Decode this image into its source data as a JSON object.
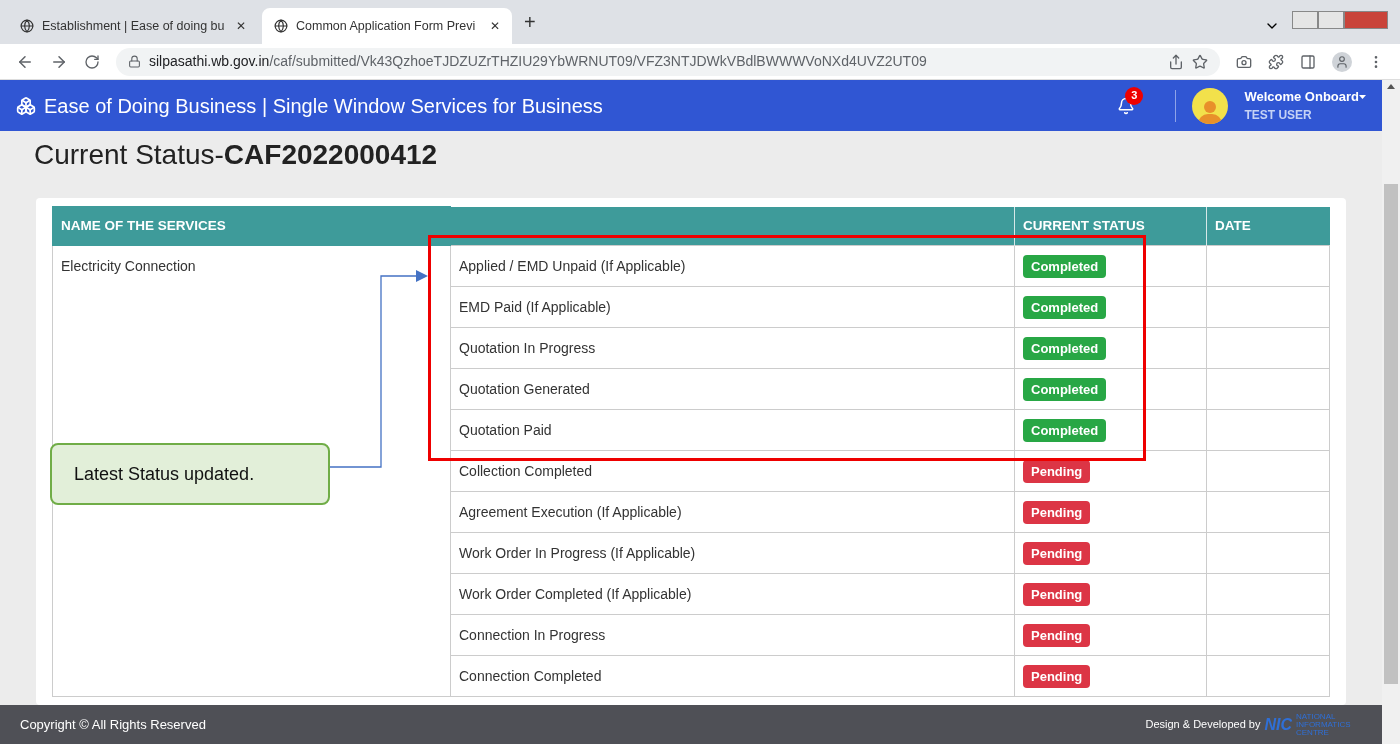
{
  "browser": {
    "tabs": [
      {
        "title": "Establishment | Ease of doing bu",
        "selected": false,
        "close": "✕"
      },
      {
        "title": "Common Application Form Previ",
        "selected": true,
        "close": "✕"
      }
    ],
    "new_tab": "+",
    "url_host": "silpasathi.wb.gov.in",
    "url_path": "/caf/submitted/Vk43QzhoeTJDZUZrTHZIU29YbWRNUT09/VFZ3NTJDWkVBdlBWWWVoNXd4UVZ2UT09"
  },
  "header": {
    "title": "Ease of Doing Business | Single Window Services for Business",
    "notification_count": "3",
    "welcome": "Welcome Onboard",
    "user": "TEST USER"
  },
  "page": {
    "title_prefix": "Current Status-",
    "title_id": "CAF2022000412"
  },
  "table": {
    "columns": [
      "NAME OF THE SERVICES",
      "CURRENT STATUS",
      "DATE"
    ],
    "service": "Electricity Connection",
    "rows": [
      {
        "step": "Applied / EMD Unpaid (If Applicable)",
        "status": "Completed",
        "kind": "completed"
      },
      {
        "step": "EMD Paid (If Applicable)",
        "status": "Completed",
        "kind": "completed"
      },
      {
        "step": "Quotation In Progress",
        "status": "Completed",
        "kind": "completed"
      },
      {
        "step": "Quotation Generated",
        "status": "Completed",
        "kind": "completed"
      },
      {
        "step": "Quotation Paid",
        "status": "Completed",
        "kind": "completed"
      },
      {
        "step": "Collection Completed",
        "status": "Pending",
        "kind": "pending"
      },
      {
        "step": "Agreement Execution (If Applicable)",
        "status": "Pending",
        "kind": "pending"
      },
      {
        "step": "Work Order In Progress (If Applicable)",
        "status": "Pending",
        "kind": "pending"
      },
      {
        "step": "Work Order Completed (If Applicable)",
        "status": "Pending",
        "kind": "pending"
      },
      {
        "step": "Connection In Progress",
        "status": "Pending",
        "kind": "pending"
      },
      {
        "step": "Connection Completed",
        "status": "Pending",
        "kind": "pending"
      }
    ]
  },
  "annotation": {
    "callout": "Latest Status updated."
  },
  "footer": {
    "copyright": "Copyright © All Rights Reserved",
    "credit": "Design & Developed by",
    "logo": "NIC",
    "logo_sub": "NATIONAL INFORMATICS CENTRE"
  }
}
